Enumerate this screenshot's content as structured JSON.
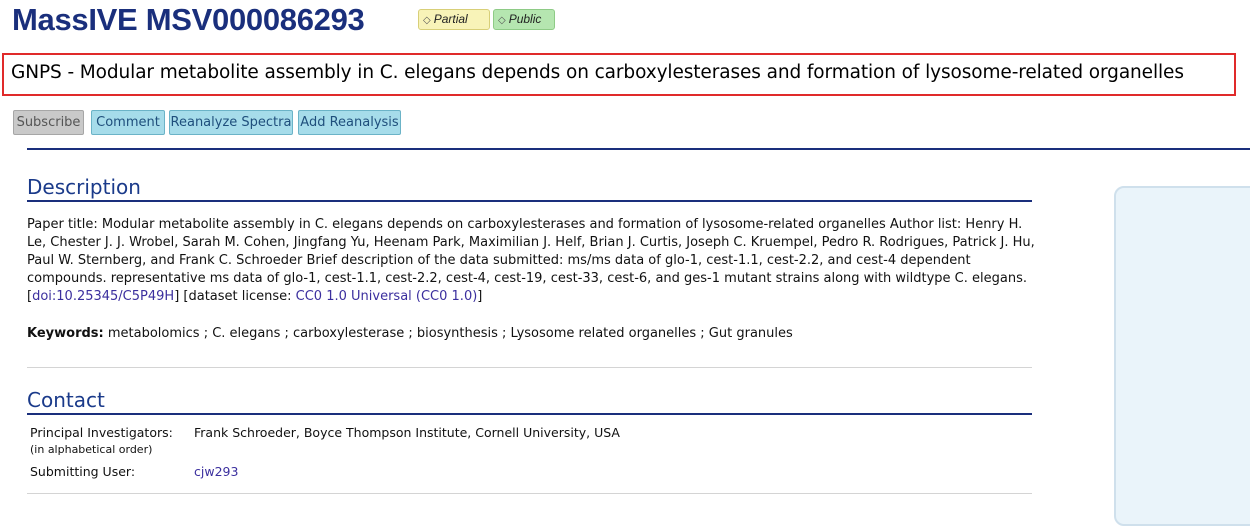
{
  "header": {
    "title": "MassIVE MSV000086293",
    "badges": [
      {
        "label": "Partial",
        "icon": "tag-icon",
        "color": "#f8f3b8"
      },
      {
        "label": "Public",
        "icon": "tag-icon",
        "color": "#b5e6b0"
      }
    ],
    "dataset_title": "GNPS - Modular metabolite assembly in C. elegans depends on carboxylesterases and formation of lysosome-related organelles"
  },
  "actions": {
    "subscribe": "Subscribe",
    "comment": "Comment",
    "reanalyze": "Reanalyze Spectra",
    "add_reanalysis": "Add Reanalysis"
  },
  "description": {
    "heading": "Description",
    "body": "Paper title: Modular metabolite assembly in C. elegans depends on carboxylesterases and formation of lysosome-related organelles Author list: Henry H. Le, Chester J. J. Wrobel, Sarah M. Cohen, Jingfang Yu, Heenam Park, Maximilian J. Helf, Brian J. Curtis, Joseph C. Kruempel, Pedro R. Rodrigues, Patrick J. Hu, Paul W. Sternberg, and Frank C. Schroeder Brief description of the data submitted: ms/ms data of glo-1, cest-1.1, cest-2.2, and cest-4 dependent compounds. representative ms data of glo-1, cest-1.1, cest-2.2, cest-4, cest-19, cest-33, cest-6, and ges-1 mutant strains along with wildtype C. elegans.",
    "doi_open": "[",
    "doi": "doi:10.25345/C5P49H",
    "license_prefix": "] [dataset license: ",
    "license": "CC0 1.0 Universal (CC0 1.0)",
    "license_close": "]",
    "keywords_label": "Keywords:",
    "keywords": " metabolomics ; C. elegans ; carboxylesterase ; biosynthesis ; Lysosome related organelles ; Gut granules"
  },
  "contact": {
    "heading": "Contact",
    "pi_label": "Principal Investigators:",
    "pi_sublabel": "(in alphabetical order)",
    "pi_value": "Frank Schroeder, Boyce Thompson Institute, Cornell University, USA",
    "user_label": "Submitting User:",
    "user_value": "cjw293"
  },
  "colors": {
    "title": "#1a2f7c",
    "link": "#3b2f9e",
    "highlight_border": "#e02a2a"
  }
}
